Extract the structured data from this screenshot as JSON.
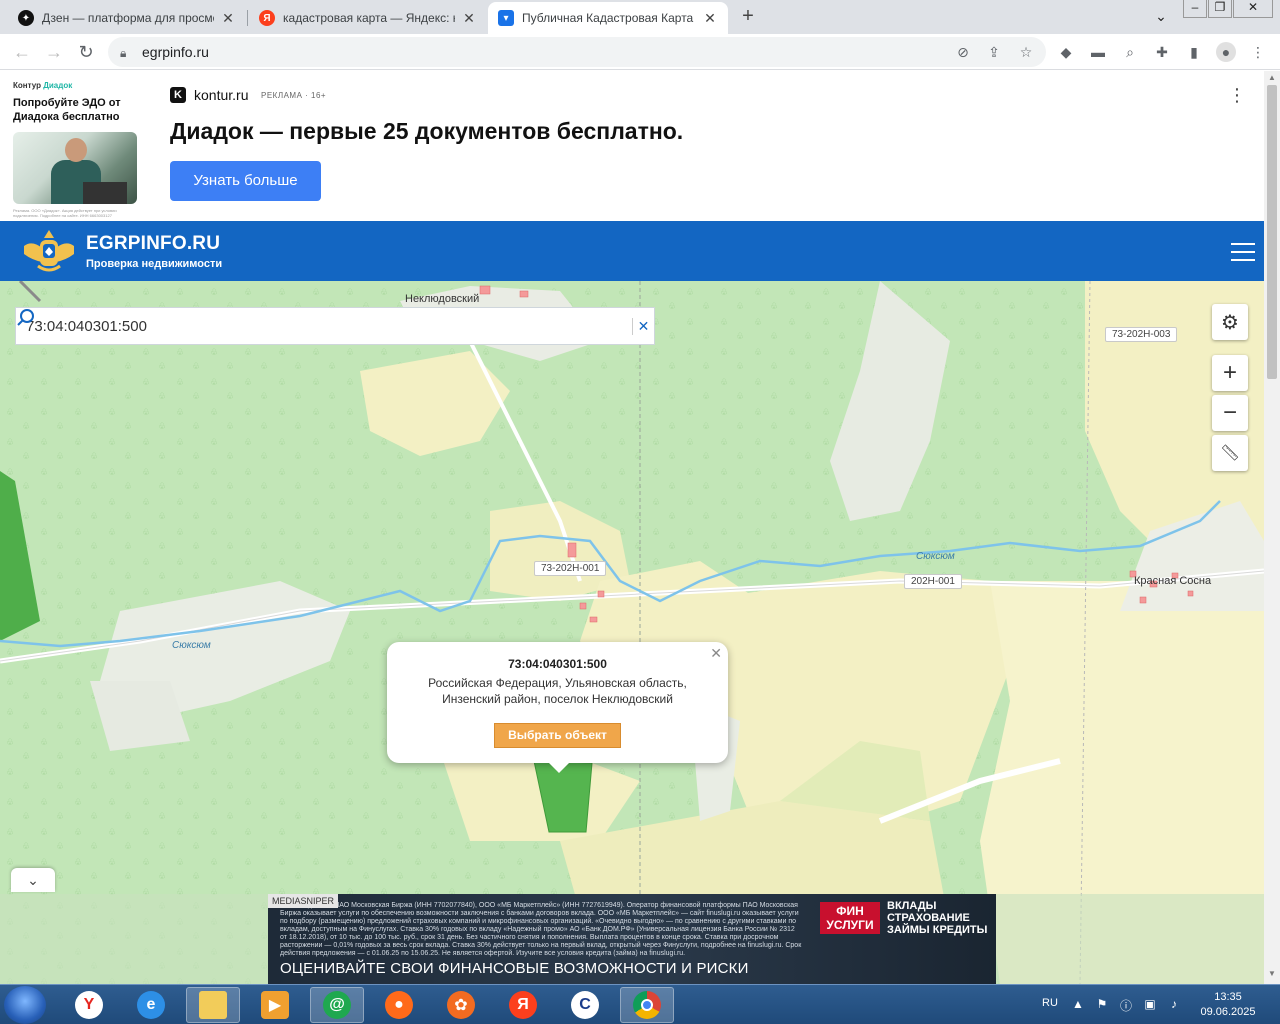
{
  "browser": {
    "tabs": [
      {
        "title": "Дзен — платформа для просмотра",
        "favicon": "dzen"
      },
      {
        "title": "кадастровая карта — Яндекс: нашлось",
        "favicon": "yandex"
      },
      {
        "title": "Публичная Кадастровая Карта Р",
        "favicon": "egrp",
        "active": true
      }
    ],
    "new_tab": "+",
    "address": "egrpinfo.ru"
  },
  "ad_top": {
    "brand_small": "Контур",
    "brand_small_accent": "Диадок",
    "left_text": "Попробуйте ЭДО от Диадока бесплатно",
    "fine_print": "Реклама. ООО «Диадок». Акция действует при условии подключения. Подробнее на сайте. ИНН 6663003127",
    "domain": "kontur.ru",
    "marker": "РЕКЛАМА · 16+",
    "headline": "Диадок — первые 25 документов бесплатно.",
    "button": "Узнать больше"
  },
  "site": {
    "title": "EGRPINFO.RU",
    "subtitle": "Проверка недвижимости"
  },
  "map": {
    "search_value": "73:04:040301:500",
    "labels": {
      "village_top": "Неклюдовский",
      "village_right": "Красная Сосна",
      "river_left": "Сюксюм",
      "river_right": "Сюксюм"
    },
    "road_tags": [
      "73-202Н-003",
      "73-202Н-001",
      "202Н-001"
    ],
    "popup": {
      "cadastral": "73:04:040301:500",
      "address_line1": "Российская Федерация, Ульяновская область,",
      "address_line2": "Инзенский район, поселок Неклюдовский",
      "button": "Выбрать объект"
    }
  },
  "ad_bottom": {
    "tag": "MEDIASNIPER",
    "fine": "Рекламодатель: ПАО Московская Биржа (ИНН 7702077840), ООО «МБ Маркетплейс» (ИНН 7727619949). Оператор финансовой платформы ПАО Московская Биржа оказывает услуги по обеспечению возможности заключения с банками договоров вклада. ООО «МБ Маркетплейс» — сайт finuslugi.ru оказывает услуги по подбору (размещению) предложений страховых компаний и микрофинансовых организаций. «Очевидно выгодно» — по сравнению с другими ставками по вкладам, доступным на Финуслугах. Ставка 30% годовых по вкладу «Надежный промо» АО «Банк ДОМ.РФ» (Универсальная лицензия Банка России № 2312 от 18.12.2018), от 10 тыс. до 100 тыс. руб., срок 31 день. Без частичного снятия и пополнения. Выплата процентов в конце срока. Ставка при досрочном расторжении — 0,01% годовых за весь срок вклада. Ставка 30% действует только на первый вклад, открытый через Финуслуги, подробнее на finuslugi.ru. Срок действия предложения — с 01.06.25 по 15.06.25. Не является офертой. Изучите все условия кредита (займа) на finuslugi.ru.",
    "headline": "ОЦЕНИВАЙТЕ СВОИ ФИНАНСОВЫЕ ВОЗМОЖНОСТИ И РИСКИ",
    "logo_line1": "ФИН",
    "logo_line2": "УСЛУГИ",
    "cat1": "ВКЛАДЫ",
    "cat2": "СТРАХОВАНИЕ",
    "cat3": "ЗАЙМЫ КРЕДИТЫ"
  },
  "taskbar": {
    "lang": "RU",
    "time": "13:35",
    "date": "09.06.2025"
  },
  "colors": {
    "site_blue": "#1366c2",
    "ad_button": "#3d7ff5",
    "popup_button": "#f0a64a"
  }
}
